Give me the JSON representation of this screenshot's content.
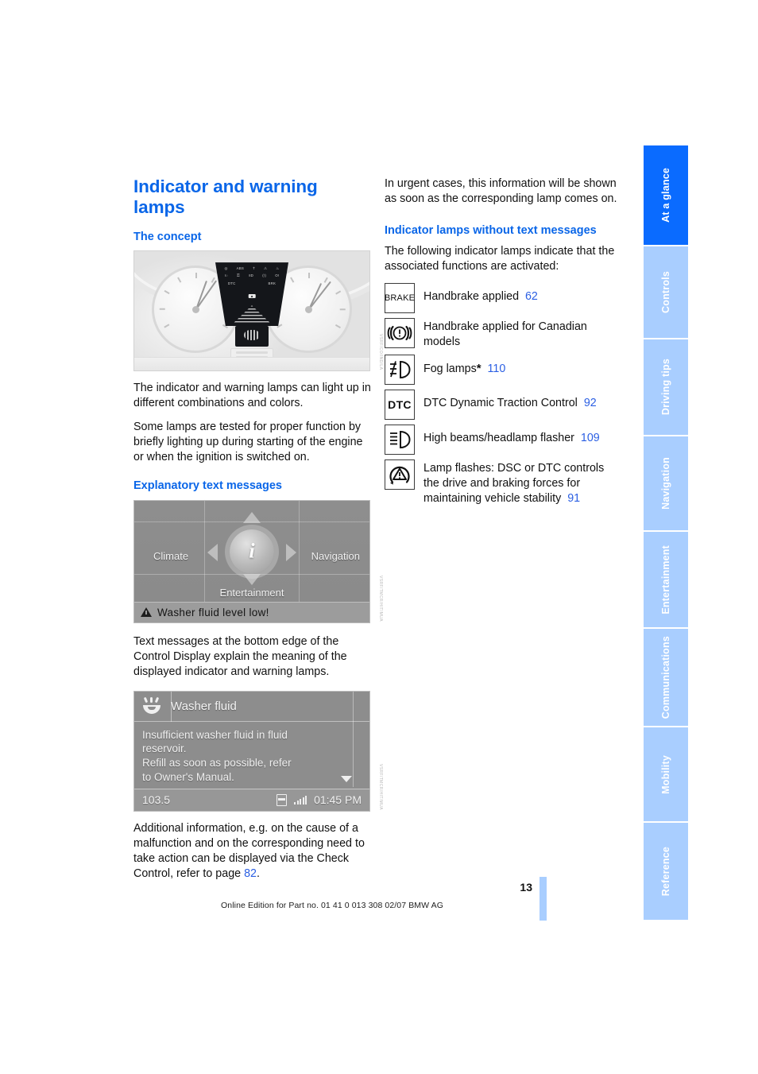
{
  "document": {
    "page_number": "13",
    "footer_line": "Online Edition for Part no. 01 41 0 013 308 02/07 BMW AG"
  },
  "left_column": {
    "title": "Indicator and warning lamps",
    "section_concept": {
      "heading": "The concept",
      "figure_code": "VSRF/CO/IND/LA",
      "paragraph_1": "The indicator and warning lamps can light up in different combinations and colors.",
      "paragraph_2": "Some lamps are tested for proper function by briefly lighting up during starting of the engine or when the ignition is switched on."
    },
    "section_text_messages": {
      "heading": "Explanatory text messages",
      "figure_code": "VSRF/TMCR/HIT/MUA",
      "idrive": {
        "climate": "Climate",
        "navigation": "Navigation",
        "entertainment": "Entertainment",
        "center_icon": "info-icon",
        "status_message": "Washer fluid level low!"
      },
      "paragraph_1": "Text messages at the bottom edge of the Control Display explain the meaning of the displayed indicator and warning lamps.",
      "washer_screen": {
        "title": "Washer fluid",
        "icon": "washer-fluid-icon",
        "body_line_1": "Insufficient washer fluid in fluid",
        "body_line_2": "reservoir.",
        "body_line_3": "Refill as soon as possible, refer",
        "body_line_4": "to Owner's Manual.",
        "station": "103.5",
        "time": "01:45 PM",
        "figure_code": "VSRF/TMCR/HIT/MUA"
      },
      "paragraph_2_pre": "Additional information, e.g. on the cause of a malfunction and on the corresponding need to take action can be displayed via the Check Control, refer to page ",
      "paragraph_2_ref": "82",
      "paragraph_2_post": "."
    }
  },
  "right_column": {
    "intro": "In urgent cases, this information will be shown as soon as the corresponding lamp comes on.",
    "heading": "Indicator lamps without text messages",
    "subtext": "The following indicator lamps indicate that the associated functions are activated:",
    "lamps": [
      {
        "icon": "brake-text-icon",
        "icon_label": "BRAKE",
        "text": "Handbrake applied",
        "page_ref": "62"
      },
      {
        "icon": "brake-warning-circle-icon",
        "icon_label": "((!))",
        "text": "Handbrake applied for Canadian models",
        "page_ref": ""
      },
      {
        "icon": "fog-lamp-icon",
        "icon_label": "",
        "text": "Fog lamps",
        "asterisk": "*",
        "page_ref": "110"
      },
      {
        "icon": "dtc-text-icon",
        "icon_label": "DTC",
        "text": "DTC Dynamic Traction Control",
        "page_ref": "92"
      },
      {
        "icon": "high-beam-icon",
        "icon_label": "",
        "text": "High beams/headlamp flasher",
        "page_ref": "109"
      },
      {
        "icon": "dsc-triangle-icon",
        "icon_label": "",
        "text": "Lamp flashes: DSC or DTC controls the drive and braking forces for maintaining vehicle stability",
        "page_ref": "91"
      }
    ]
  },
  "sidebar": {
    "tabs": [
      {
        "label": "At a glance",
        "active": true
      },
      {
        "label": "Controls",
        "active": false
      },
      {
        "label": "Driving tips",
        "active": false
      },
      {
        "label": "Navigation",
        "active": false
      },
      {
        "label": "Entertainment",
        "active": false
      },
      {
        "label": "Communications",
        "active": false
      },
      {
        "label": "Mobility",
        "active": false
      },
      {
        "label": "Reference",
        "active": false
      }
    ]
  },
  "colors": {
    "accent_blue": "#0a66e8",
    "tab_active": "#0a6bff",
    "tab_idle": "#a9ceff",
    "page_ref": "#2b5fe3"
  }
}
